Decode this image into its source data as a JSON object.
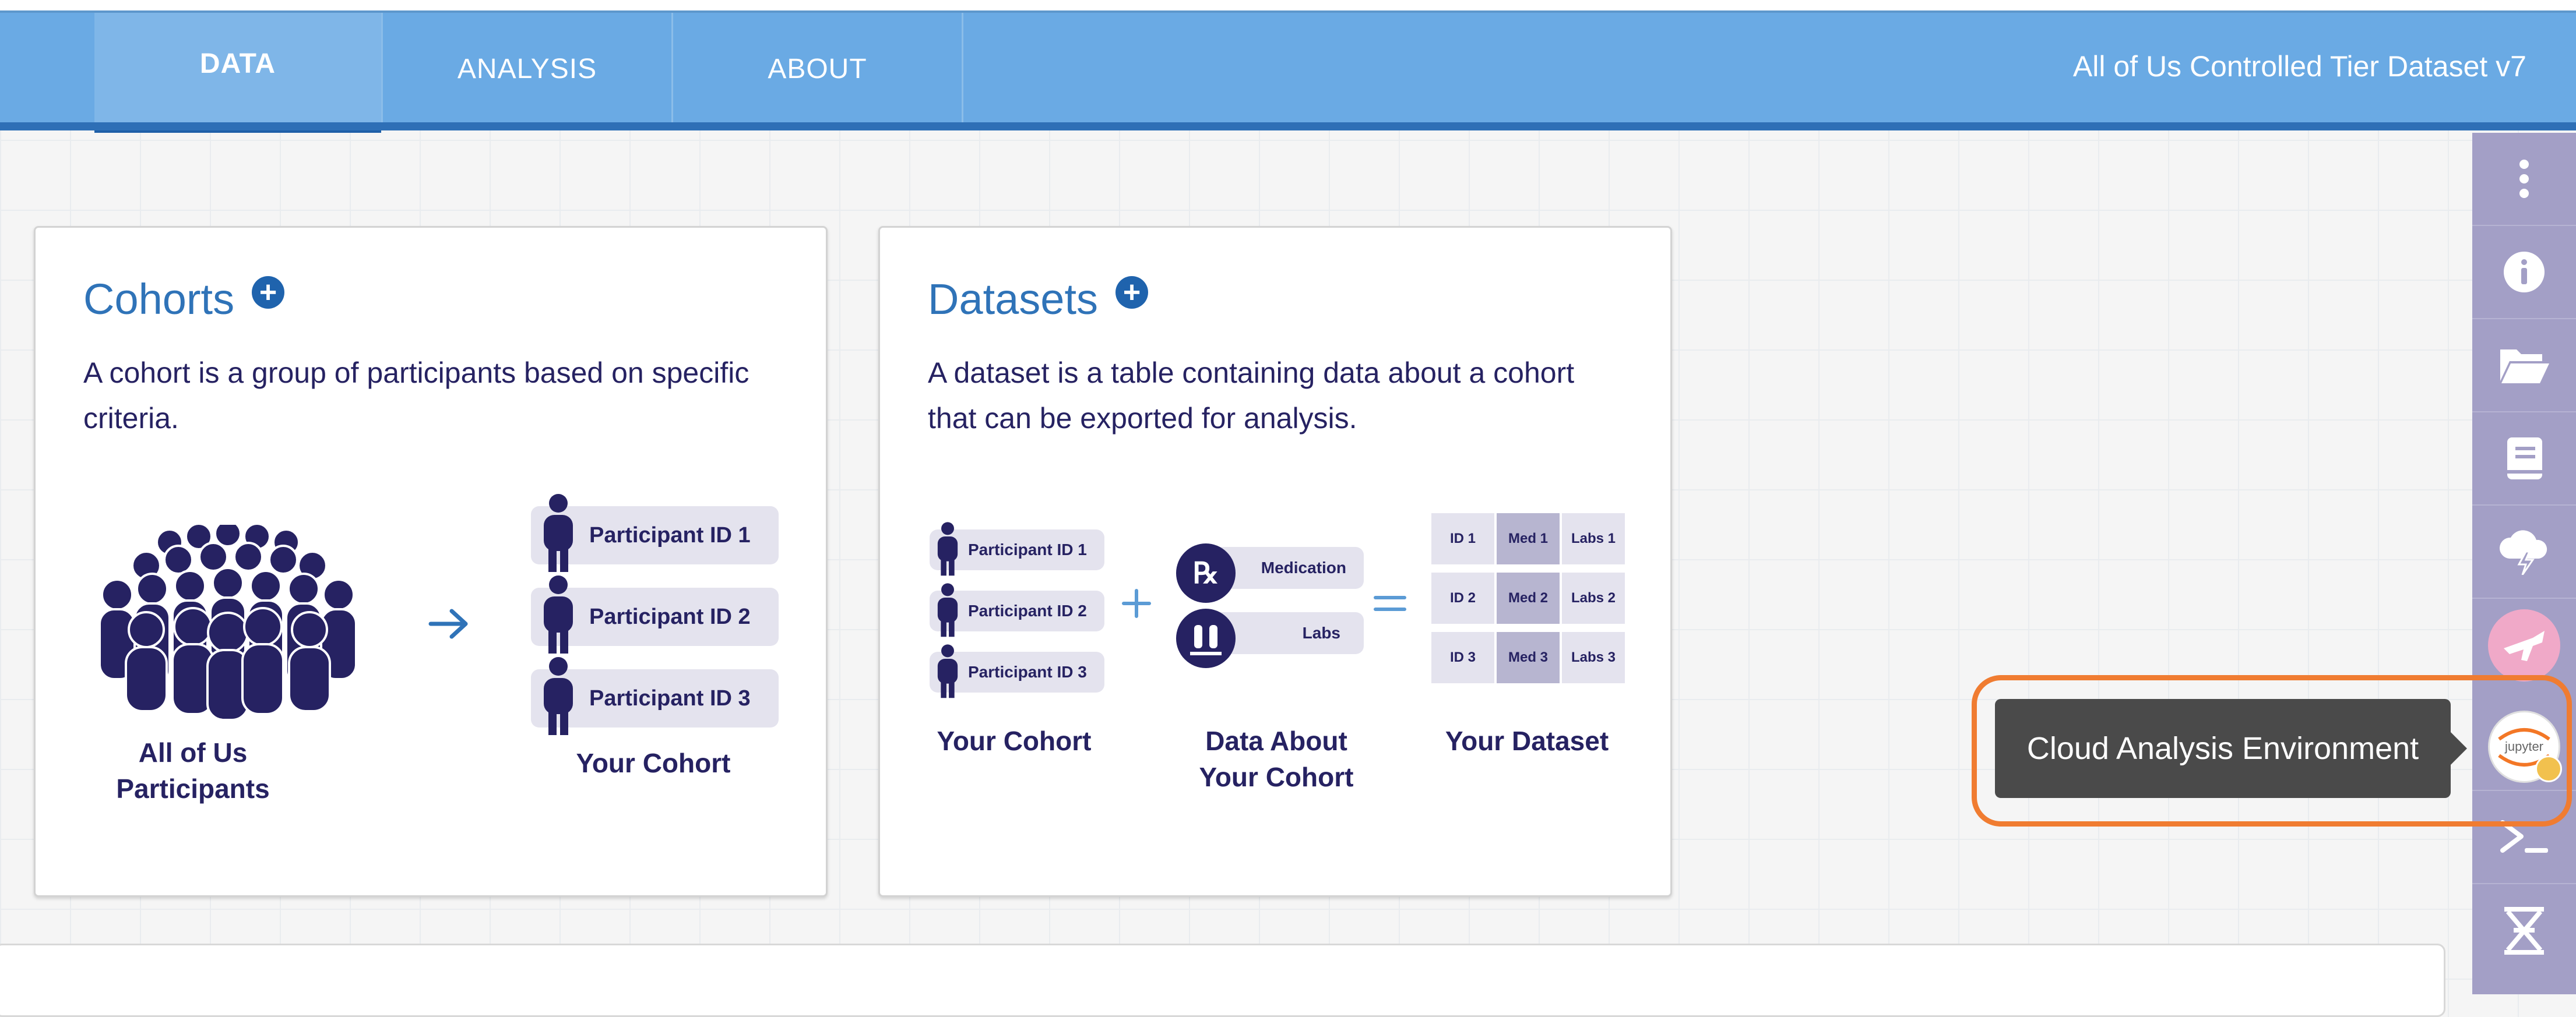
{
  "nav": {
    "tabs": [
      {
        "label": "DATA"
      },
      {
        "label": "ANALYSIS"
      },
      {
        "label": "ABOUT"
      }
    ],
    "dataset_title": "All of Us Controlled Tier Dataset v7"
  },
  "cohorts_card": {
    "title": "Cohorts",
    "description": "A cohort is a group of participants based on specific criteria.",
    "crowd_label_line1": "All of Us",
    "crowd_label_line2": "Participants",
    "participants": [
      "Participant ID 1",
      "Participant ID 2",
      "Participant ID 3"
    ],
    "result_label": "Your Cohort"
  },
  "datasets_card": {
    "title": "Datasets",
    "description": "A dataset is a table containing data about a cohort that can be exported for analysis.",
    "participants": [
      "Participant ID 1",
      "Participant ID 2",
      "Participant ID 3"
    ],
    "cohort_label": "Your Cohort",
    "data_items": [
      "Medication",
      "Labs"
    ],
    "data_label_line1": "Data About",
    "data_label_line2": "Your Cohort",
    "dataset_table": [
      [
        "ID 1",
        "Med 1",
        "Labs 1"
      ],
      [
        "ID 2",
        "Med 2",
        "Labs 2"
      ],
      [
        "ID 3",
        "Med 3",
        "Labs 3"
      ]
    ],
    "dataset_label": "Your Dataset"
  },
  "sidebar": {
    "icons": [
      "more-vertical-icon",
      "info-icon",
      "folder-open-icon",
      "book-icon",
      "cloud-lightning-icon",
      "genomics-avatar-icon",
      "jupyter-icon",
      "terminal-icon",
      "dna-icon"
    ],
    "jupyter_text": "jupyter"
  },
  "tooltip": {
    "text": "Cloud Analysis Environment"
  },
  "colors": {
    "nav": "#6aaae4",
    "nav_accent": "#2e6fb6",
    "title_blue": "#2f73b8",
    "navy": "#262262",
    "sidebar": "#a39fc6",
    "highlight": "#f07c31"
  }
}
